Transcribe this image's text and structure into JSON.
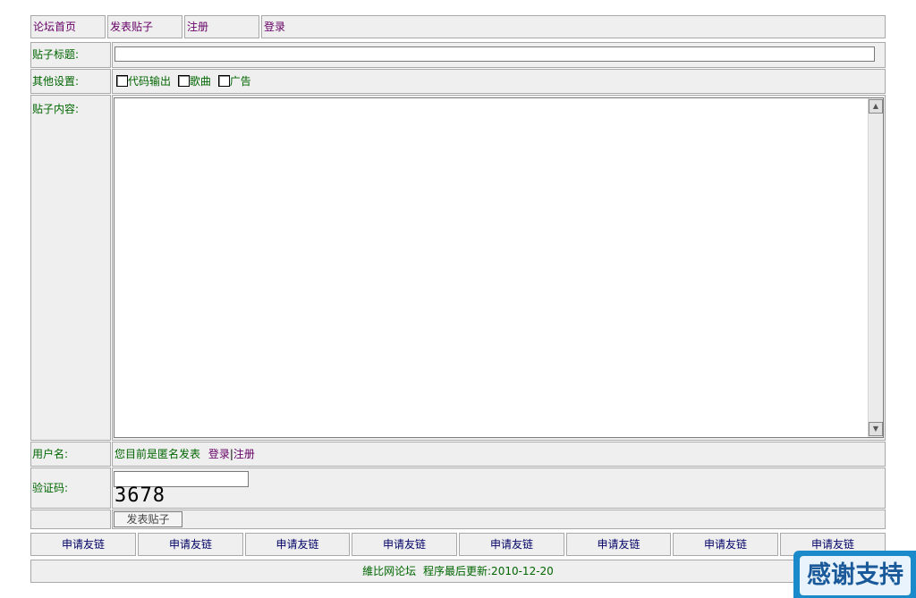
{
  "nav": {
    "home": "论坛首页",
    "post": "发表贴子",
    "register": "注册",
    "login": "登录"
  },
  "form": {
    "title_label": "贴子标题:",
    "title_value": "",
    "settings_label": "其他设置:",
    "options": [
      "代码输出",
      "歌曲",
      "广告"
    ],
    "content_label": "贴子内容:",
    "content_value": "",
    "username_label": "用户名:",
    "anon_text": "您目前是匿名发表",
    "login_link": "登录",
    "separator": "|",
    "register_link": "注册",
    "captcha_label": "验证码:",
    "captcha_value": "",
    "captcha_code": "3678",
    "submit_label": "发表贴子"
  },
  "friend_links": [
    "申请友链",
    "申请友链",
    "申请友链",
    "申请友链",
    "申请友链",
    "申请友链",
    "申请友链",
    "申请友链"
  ],
  "footer": {
    "site_name": "維比网论坛",
    "updated_text": "程序最后更新:2010-12-20"
  },
  "badge": {
    "text": "感谢支持"
  },
  "colors": {
    "cell_bg": "#efefef",
    "border": "#a9a9a9",
    "link_purple": "#660066",
    "label_green": "#006600",
    "friend_link_blue": "#000066",
    "badge_blue": "#1a8acb"
  }
}
